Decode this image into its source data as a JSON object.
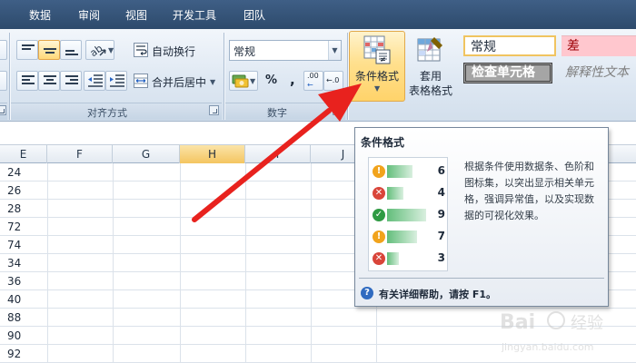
{
  "menu": {
    "tabs": [
      "数据",
      "审阅",
      "视图",
      "开发工具",
      "团队"
    ]
  },
  "ribbon": {
    "alignment": {
      "wrap_text": "自动换行",
      "merge_center": "合并后居中",
      "group_label": "对齐方式"
    },
    "number": {
      "format_value": "常规",
      "percent": "%",
      "comma": ",",
      "increase_decimal": ".00",
      "decrease_decimal": "←.0",
      "group_label": "数字"
    },
    "styles": {
      "conditional_format": "条件格式",
      "table_format_line1": "套用",
      "table_format_line2": "表格格式",
      "cell_styles": {
        "normal": "常规",
        "bad": "差",
        "check_cell": "检查单元格",
        "explanatory": "解释性文本"
      }
    }
  },
  "grid": {
    "columns": [
      "E",
      "F",
      "G",
      "H",
      "I",
      "J"
    ],
    "selected_column": "H",
    "column_e_values": [
      "24",
      "26",
      "28",
      "72",
      "74",
      "34",
      "36",
      "40",
      "88",
      "90",
      "92"
    ]
  },
  "tooltip": {
    "title": "条件格式",
    "preview_rows": [
      {
        "icon": "warning",
        "value": "6",
        "fill": 0.55
      },
      {
        "icon": "error",
        "value": "4",
        "fill": 0.35
      },
      {
        "icon": "ok",
        "value": "9",
        "fill": 0.85
      },
      {
        "icon": "warning",
        "value": "7",
        "fill": 0.65
      },
      {
        "icon": "error",
        "value": "3",
        "fill": 0.25
      }
    ],
    "description": "根据条件使用数据条、色阶和图标集，以突出显示相关单元格，强调异常值，以及实现数据的可视化效果。",
    "help": "有关详细帮助，请按 F1。"
  },
  "colors": {
    "accent_red": "#e8221e",
    "hot_button": "#ffd36a",
    "selected_header": "#f4c560"
  },
  "watermark": {
    "brand": "Bai",
    "brand_cn": "经验",
    "url": "jingyan.baidu.com"
  }
}
